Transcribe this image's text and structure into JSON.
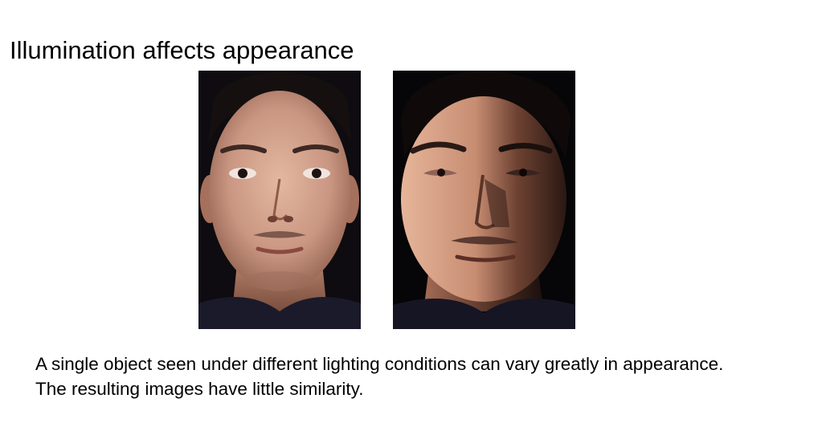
{
  "slide": {
    "title": "Illumination affects appearance",
    "photos": [
      {
        "icon": "face-photo-frontal-lighting-icon",
        "lighting": "frontal"
      },
      {
        "icon": "face-photo-side-lighting-icon",
        "lighting": "side"
      }
    ],
    "caption": {
      "line1": "A single object seen under different lighting conditions can vary greatly in appearance.",
      "line2": "The resulting images have little similarity."
    }
  },
  "colors": {
    "background": "#ffffff",
    "text": "#000000",
    "photo_background": "#0c0a0e",
    "skin_lit": "#d6a48a",
    "skin_shadow": "#6e4232"
  }
}
